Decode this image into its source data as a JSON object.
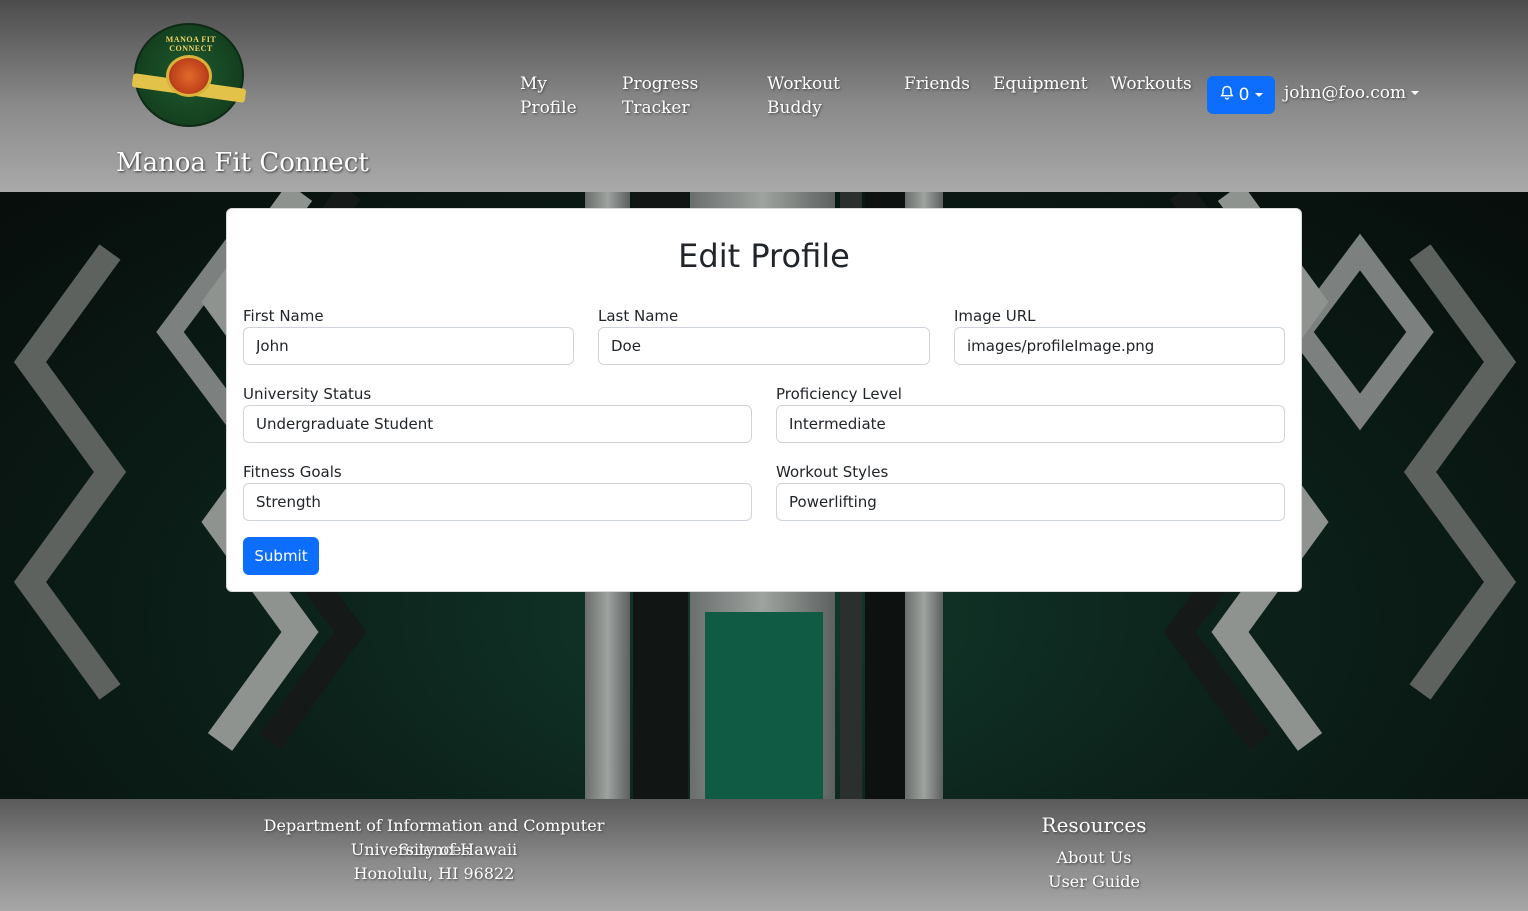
{
  "header": {
    "brand": "Manoa Fit Connect",
    "logo_text": "MANOA FIT CONNECT",
    "nav": [
      {
        "line1": "My",
        "line2": "Profile"
      },
      {
        "line1": "Progress",
        "line2": "Tracker"
      },
      {
        "line1": "Workout",
        "line2": "Buddy"
      },
      {
        "line1": "Friends",
        "line2": ""
      },
      {
        "line1": "Equipment",
        "line2": ""
      },
      {
        "line1": "Workouts",
        "line2": ""
      }
    ],
    "notifications_count": "0",
    "user_email": "john@foo.com"
  },
  "form": {
    "title": "Edit Profile",
    "first_name_label": "First Name",
    "first_name_value": "John",
    "last_name_label": "Last Name",
    "last_name_value": "Doe",
    "image_url_label": "Image URL",
    "image_url_value": "images/profileImage.png",
    "university_status_label": "University Status",
    "university_status_value": "Undergraduate Student",
    "proficiency_label": "Proficiency Level",
    "proficiency_value": "Intermediate",
    "fitness_goals_label": "Fitness Goals",
    "fitness_goals_value": "Strength",
    "workout_styles_label": "Workout Styles",
    "workout_styles_value": "Powerlifting",
    "submit_label": "Submit"
  },
  "footer": {
    "dept": "Department of Information and Computer Sciences",
    "university": "University of Hawaii",
    "address": "Honolulu, HI 96822",
    "resources_title": "Resources",
    "about": "About Us",
    "guide": "User Guide"
  },
  "colors": {
    "primary": "#0d6efd",
    "background_green": "#0c211a"
  }
}
